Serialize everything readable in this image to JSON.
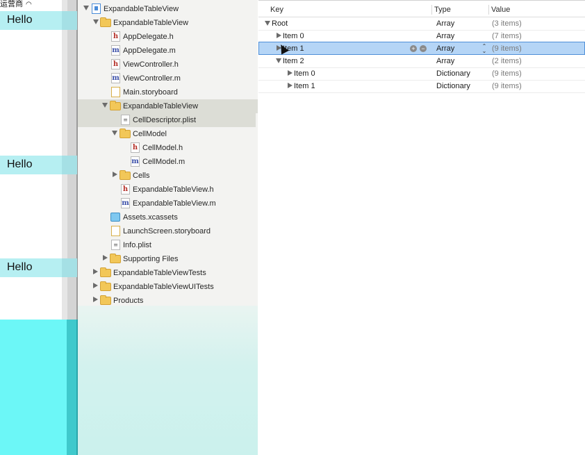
{
  "simulator": {
    "carrier": "运营商",
    "rows": [
      "Hello",
      "Hello",
      "Hello"
    ]
  },
  "navigator": {
    "items": [
      {
        "label": "ExpandableTableView",
        "kind": "project",
        "icon": "project-icon",
        "expanded": true
      },
      {
        "label": "ExpandableTableView",
        "kind": "folder",
        "icon": "folder-icon",
        "expanded": true
      },
      {
        "label": "AppDelegate.h",
        "kind": "file",
        "icon": "header-file-icon",
        "glyph": "h"
      },
      {
        "label": "AppDelegate.m",
        "kind": "file",
        "icon": "implementation-file-icon",
        "glyph": "m"
      },
      {
        "label": "ViewController.h",
        "kind": "file",
        "icon": "header-file-icon",
        "glyph": "h"
      },
      {
        "label": "ViewController.m",
        "kind": "file",
        "icon": "implementation-file-icon",
        "glyph": "m"
      },
      {
        "label": "Main.storyboard",
        "kind": "file",
        "icon": "storyboard-file-icon"
      },
      {
        "label": "ExpandableTableView",
        "kind": "folder",
        "icon": "folder-icon",
        "expanded": true,
        "selected": true
      },
      {
        "label": "CellDescriptor.plist",
        "kind": "file",
        "icon": "plist-file-icon"
      },
      {
        "label": "CellModel",
        "kind": "folder",
        "icon": "folder-icon",
        "expanded": true
      },
      {
        "label": "CellModel.h",
        "kind": "file",
        "icon": "header-file-icon",
        "glyph": "h"
      },
      {
        "label": "CellModel.m",
        "kind": "file",
        "icon": "implementation-file-icon",
        "glyph": "m"
      },
      {
        "label": "Cells",
        "kind": "folder",
        "icon": "folder-icon",
        "expanded": false
      },
      {
        "label": "ExpandableTableView.h",
        "kind": "file",
        "icon": "header-file-icon",
        "glyph": "h"
      },
      {
        "label": "ExpandableTableView.m",
        "kind": "file",
        "icon": "implementation-file-icon",
        "glyph": "m"
      },
      {
        "label": "Assets.xcassets",
        "kind": "file",
        "icon": "asset-catalog-icon"
      },
      {
        "label": "LaunchScreen.storyboard",
        "kind": "file",
        "icon": "storyboard-file-icon"
      },
      {
        "label": "Info.plist",
        "kind": "file",
        "icon": "plist-file-icon"
      },
      {
        "label": "Supporting Files",
        "kind": "folder",
        "icon": "folder-icon",
        "expanded": false
      },
      {
        "label": "ExpandableTableViewTests",
        "kind": "folder",
        "icon": "folder-icon",
        "expanded": false
      },
      {
        "label": "ExpandableTableViewUITests",
        "kind": "folder",
        "icon": "folder-icon",
        "expanded": false
      },
      {
        "label": "Products",
        "kind": "folder",
        "icon": "folder-icon",
        "expanded": false
      }
    ]
  },
  "editor": {
    "headers": {
      "key": "Key",
      "type": "Type",
      "value": "Value"
    },
    "rows": [
      {
        "key": "Root",
        "type": "Array",
        "value": "(3 items)",
        "expanded": true
      },
      {
        "key": "Item 0",
        "type": "Array",
        "value": "(7 items)",
        "expanded": false
      },
      {
        "key": "Item 1",
        "type": "Array",
        "value": "(9 items)",
        "expanded": false,
        "selected": true
      },
      {
        "key": "Item 2",
        "type": "Array",
        "value": "(2 items)",
        "expanded": true
      },
      {
        "key": "Item 0",
        "type": "Dictionary",
        "value": "(9 items)",
        "expanded": false
      },
      {
        "key": "Item 1",
        "type": "Dictionary",
        "value": "(9 items)",
        "expanded": false
      }
    ],
    "row_controls": {
      "add_glyph": "+",
      "remove_glyph": "−"
    }
  },
  "colors": {
    "selection_blue": "#b5d5f6",
    "navigator_selection": "#dcddd6",
    "simulator_cell": "#b6eff2",
    "simulator_cyan": "#6cf7f7"
  }
}
